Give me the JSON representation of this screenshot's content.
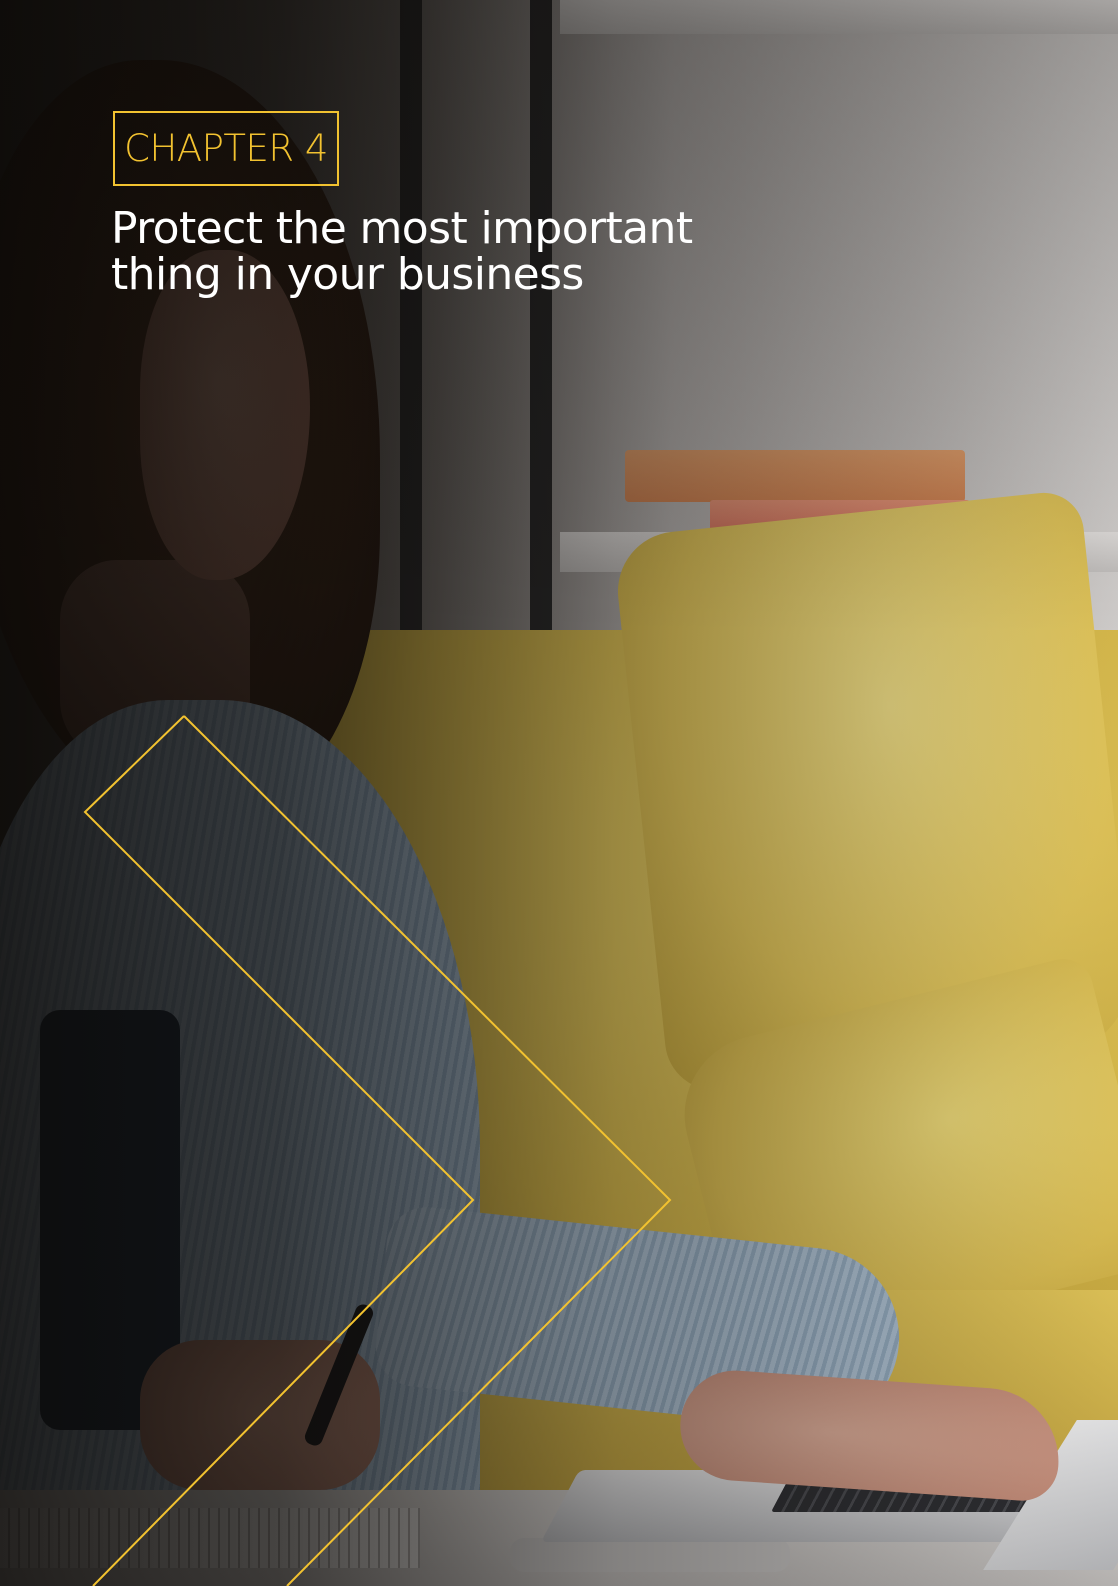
{
  "chapter": {
    "label": "CHAPTER 4"
  },
  "headline": {
    "line1": "Protect the most important",
    "line2": "thing in your business"
  },
  "colors": {
    "accent": "#f2c230",
    "headline_text": "#ffffff",
    "background_dark": "#1a1714"
  },
  "graphics": {
    "background_photo": "woman-working-on-laptop-with-yellow-cushions",
    "decoration": "double-chevron-outline"
  }
}
